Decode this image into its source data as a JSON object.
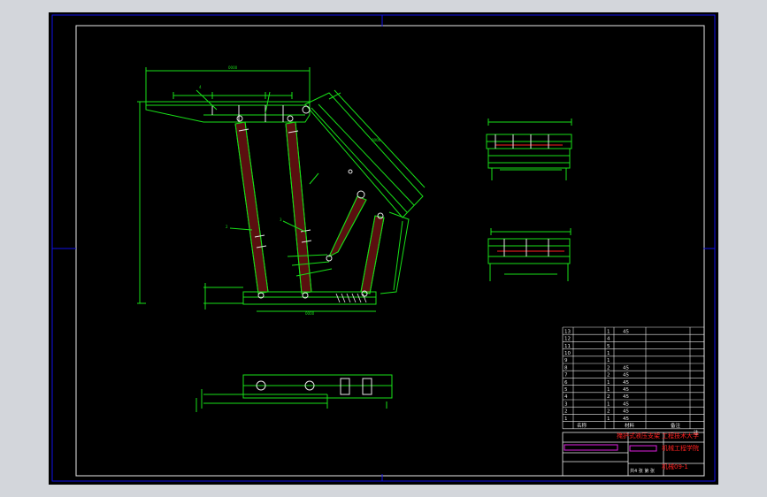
{
  "colors": {
    "background": "#d3d6db",
    "sheet": "#000000",
    "border": "#1010e8",
    "line": "#18e018",
    "white_line": "#e8e8e8",
    "accent_red": "#ff2020",
    "dark_red": "#5a0f0f",
    "magenta": "#e020e0",
    "cyan": "#20e0e0",
    "yellow": "#e8e820"
  },
  "icons": {
    "crosshair": "crosshair-icon"
  },
  "title_block": {
    "parts_rows": [
      {
        "no": "13",
        "name": "",
        "qty": "1",
        "material": "45"
      },
      {
        "no": "12",
        "name": "",
        "qty": "4",
        "material": ""
      },
      {
        "no": "11",
        "name": "",
        "qty": "5",
        "material": ""
      },
      {
        "no": "10",
        "name": "",
        "qty": "1",
        "material": ""
      },
      {
        "no": "9",
        "name": "",
        "qty": "1",
        "material": ""
      },
      {
        "no": "8",
        "name": "",
        "qty": "2",
        "material": "45"
      },
      {
        "no": "7",
        "name": "",
        "qty": "2",
        "material": "45"
      },
      {
        "no": "6",
        "name": "",
        "qty": "1",
        "material": "45"
      },
      {
        "no": "5",
        "name": "",
        "qty": "1",
        "material": "45"
      },
      {
        "no": "4",
        "name": "",
        "qty": "2",
        "material": "45"
      },
      {
        "no": "3",
        "name": "",
        "qty": "1",
        "material": "45"
      },
      {
        "no": "2",
        "name": "",
        "qty": "2",
        "material": "45"
      },
      {
        "no": "1",
        "name": "",
        "qty": "1",
        "material": "45"
      }
    ],
    "header": {
      "name": "名称",
      "qty": "",
      "material": "材料",
      "remark": "备注"
    },
    "header_top_right": "注",
    "drawing_title": "掩护式液压支架",
    "school_line1": "工程技术大学",
    "school_line2": "机械工程学院",
    "drawing_no": "机械09-1",
    "bottom_left": "",
    "bottom_mid": "共4 张 第 张"
  }
}
